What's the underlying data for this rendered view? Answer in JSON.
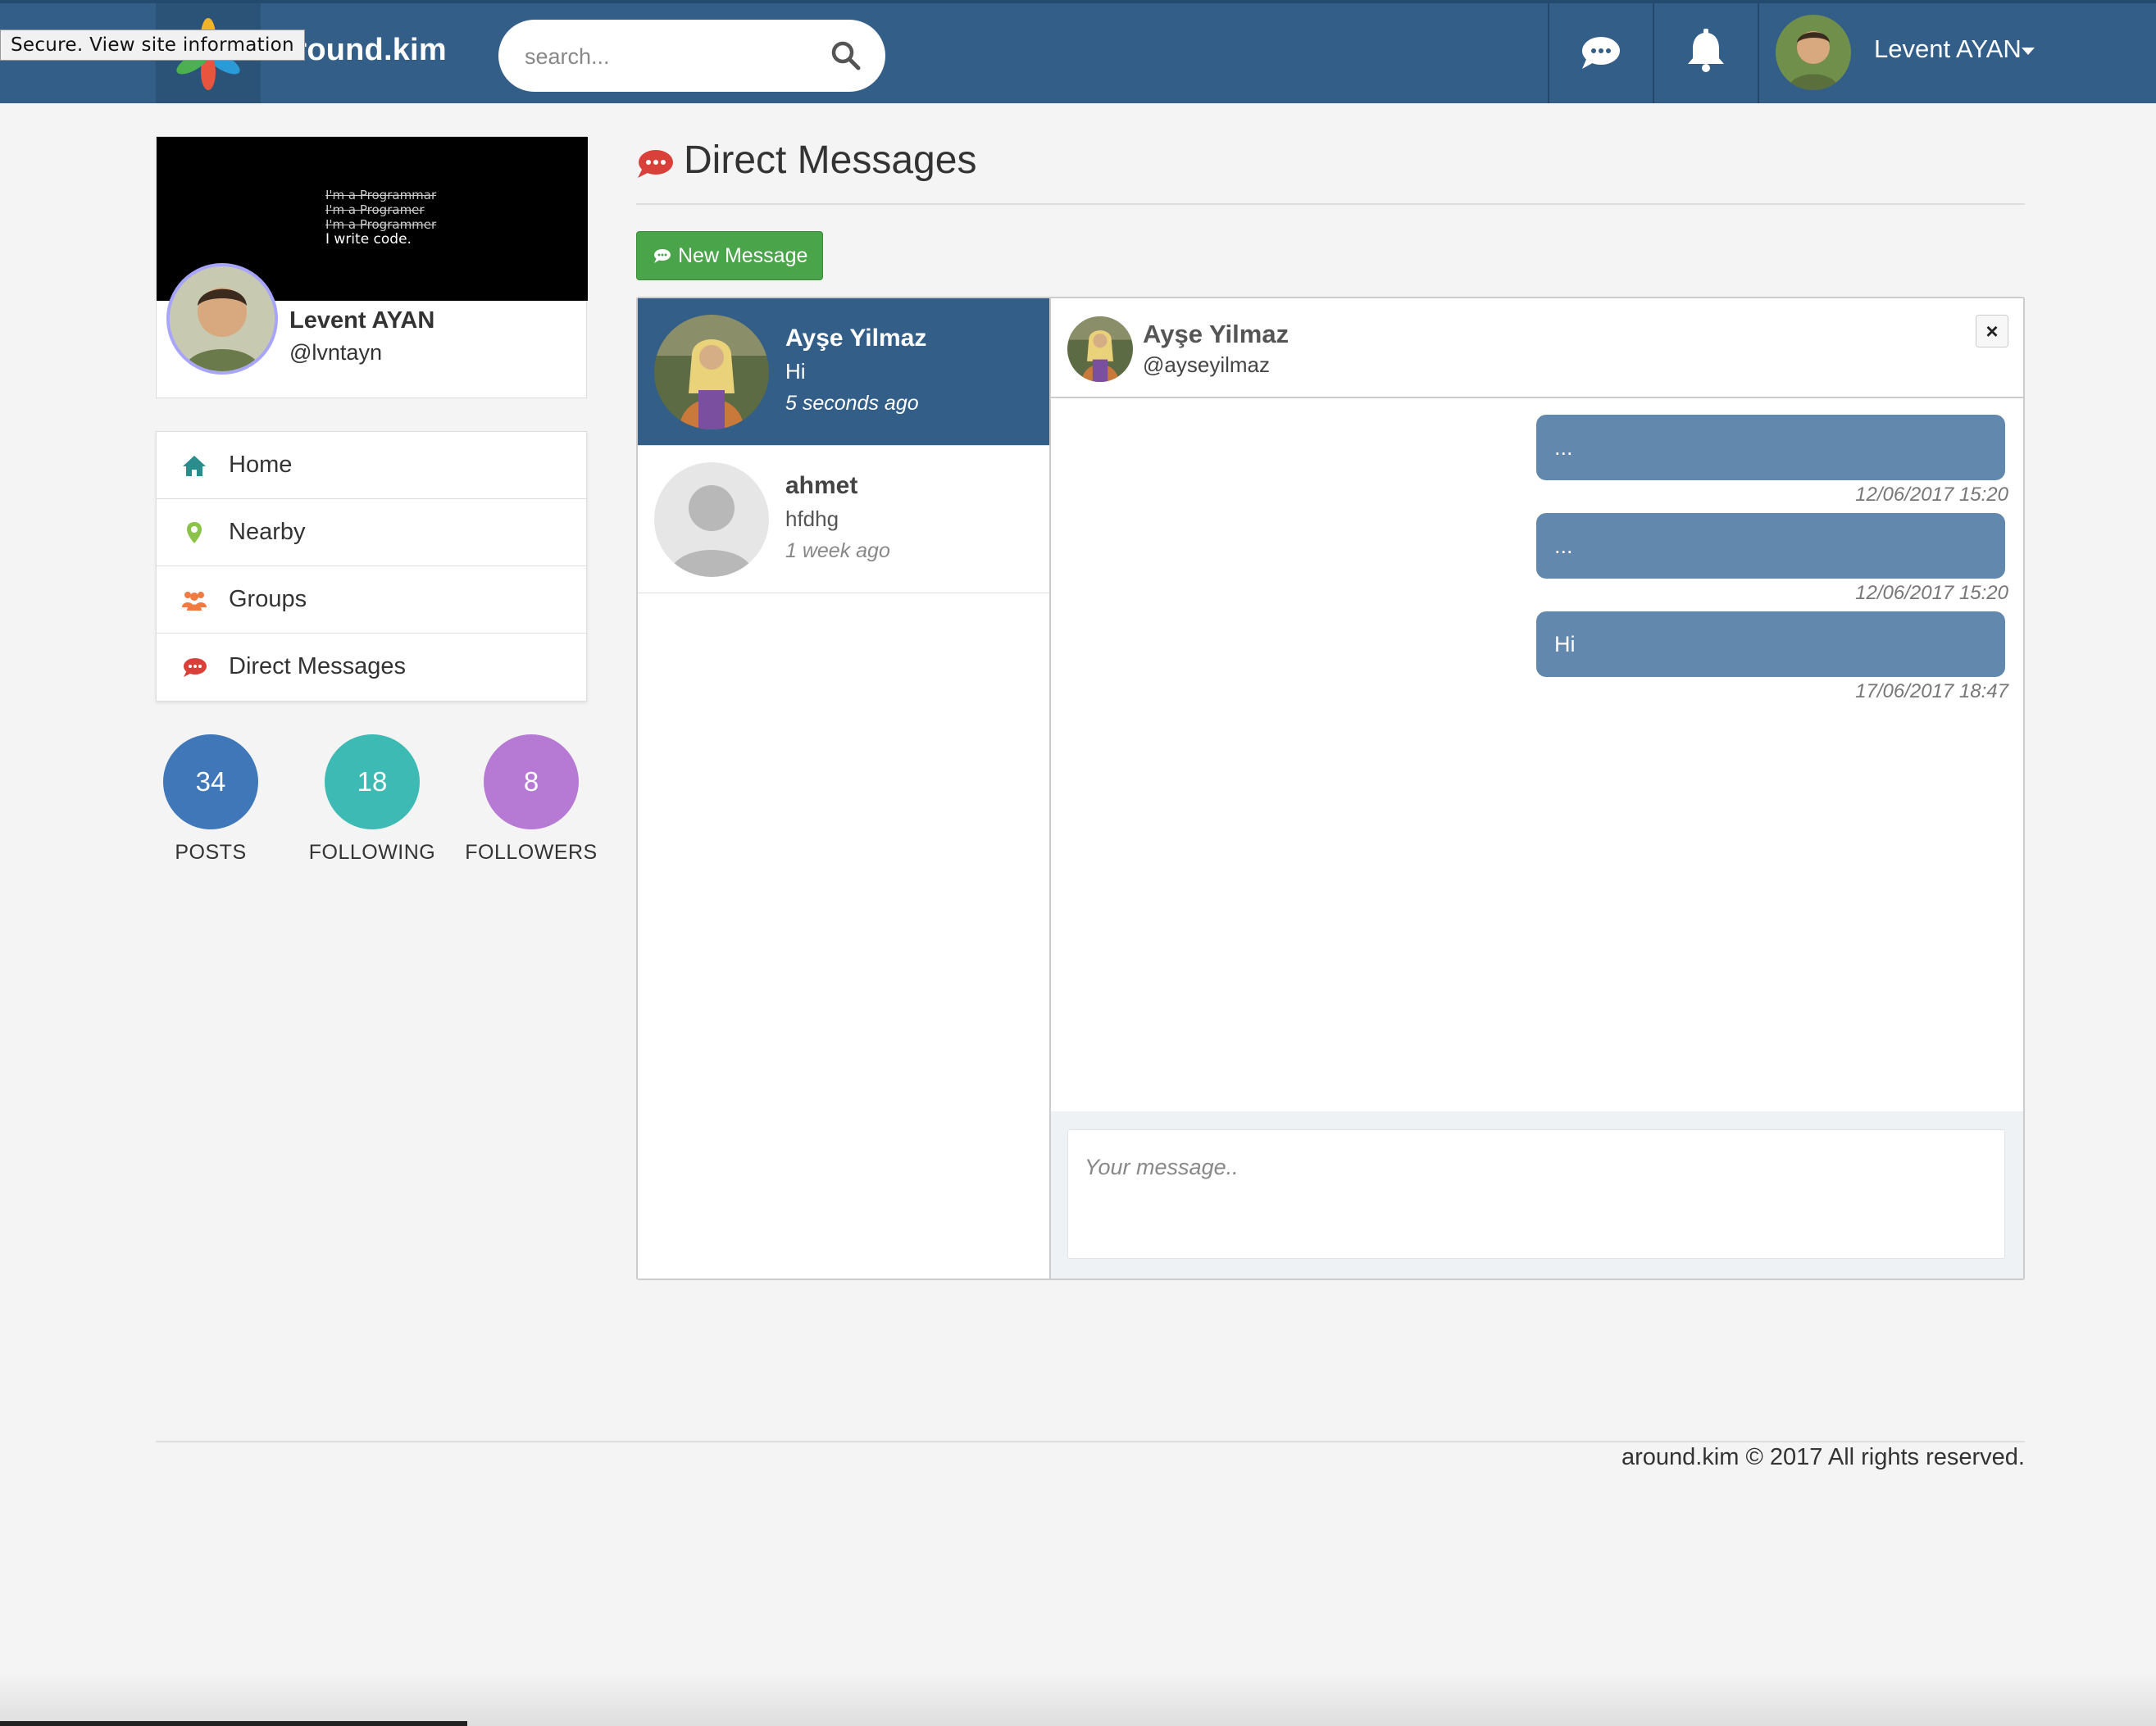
{
  "browser": {
    "tooltip": "Secure. View site information"
  },
  "header": {
    "brand": "around.kim",
    "search_placeholder": "search...",
    "user_name": "Levent AYAN"
  },
  "profile": {
    "cover_lines": [
      "I'm a Programmar",
      "I'm a Programer",
      "I'm a Programmer",
      "I write code."
    ],
    "name": "Levent AYAN",
    "handle": "@lvntayn"
  },
  "menu": {
    "items": [
      {
        "label": "Home",
        "icon": "home-icon",
        "color": "#2a8c8c"
      },
      {
        "label": "Nearby",
        "icon": "map-marker-icon",
        "color": "#8bc34a"
      },
      {
        "label": "Groups",
        "icon": "users-icon",
        "color": "#f07a3f"
      },
      {
        "label": "Direct Messages",
        "icon": "comment-icon",
        "color": "#d9403a"
      }
    ]
  },
  "stats": [
    {
      "value": "34",
      "label": "POSTS",
      "color": "#3f77b9"
    },
    {
      "value": "18",
      "label": "FOLLOWING",
      "color": "#3dbab3"
    },
    {
      "value": "8",
      "label": "FOLLOWERS",
      "color": "#b77ad4"
    }
  ],
  "main": {
    "title": "Direct Messages",
    "new_message_label": "New Message"
  },
  "conversations": [
    {
      "name": "Ayşe Yilmaz",
      "preview": "Hi",
      "time": "5 seconds ago",
      "active": true
    },
    {
      "name": "ahmet",
      "preview": "hfdhg",
      "time": "1 week ago",
      "active": false
    }
  ],
  "chat": {
    "name": "Ayşe Yilmaz",
    "handle": "@ayseyilmaz",
    "close_label": "×",
    "messages": [
      {
        "text": "...",
        "time": "12/06/2017 15:20"
      },
      {
        "text": "...",
        "time": "12/06/2017 15:20"
      },
      {
        "text": "Hi",
        "time": "17/06/2017 18:47"
      }
    ],
    "input_placeholder": "Your message.."
  },
  "footer": {
    "text": "around.kim © 2017 All rights reserved."
  }
}
